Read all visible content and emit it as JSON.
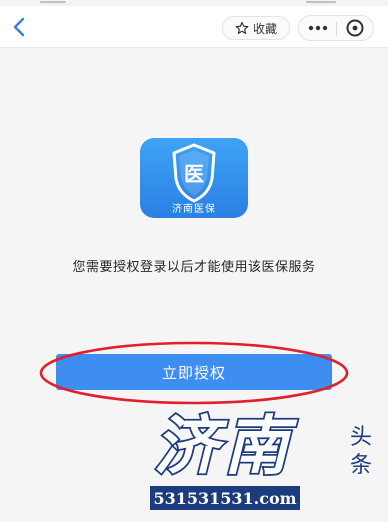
{
  "navbar": {
    "back_icon": "chevron-left-icon",
    "favorite": {
      "icon": "star-icon",
      "label": "收藏"
    },
    "capsule": {
      "more_icon": "more-dots-icon",
      "close_icon": "close-circle-icon"
    }
  },
  "app": {
    "logo_glyph": "医",
    "logo_label": "济南医保",
    "logo_color": "#2f8cec"
  },
  "authorization": {
    "description": "您需要授权登录以后才能使用该医保服务",
    "button_label": "立即授权",
    "button_color": "#3d8ef0",
    "highlight_color": "#e0202a"
  },
  "watermark": {
    "brand": "济南",
    "side_label": "头条",
    "url": "531531531.com"
  },
  "colors": {
    "accent": "#3d8ef0",
    "background": "#f5f5f6",
    "watermark_blue": "#1c3c7d"
  }
}
